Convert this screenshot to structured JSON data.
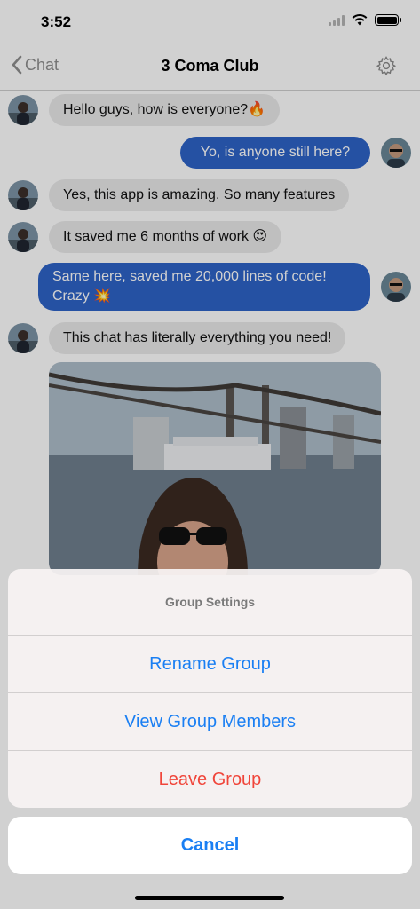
{
  "status_bar": {
    "time": "3:52"
  },
  "nav": {
    "back_label": "Chat",
    "title": "3 Coma Club"
  },
  "messages": [
    {
      "text": "Hello guys, how is everyone?🔥",
      "direction": "incoming"
    },
    {
      "text": "Yo, is anyone still here?",
      "direction": "outgoing"
    },
    {
      "text": "Yes, this app is amazing. So many features",
      "direction": "incoming"
    },
    {
      "text": "It saved me 6 months of work 😍",
      "direction": "incoming"
    },
    {
      "text": "Same here, saved me 20,000 lines of code! Crazy 💥",
      "direction": "outgoing"
    },
    {
      "text": "This chat has literally everything you need!",
      "direction": "incoming"
    }
  ],
  "action_sheet": {
    "title": "Group Settings",
    "options": [
      "Rename Group",
      "View Group Members",
      "Leave Group"
    ],
    "cancel_label": "Cancel"
  },
  "colors": {
    "outgoing_bubble": "#2e63c7",
    "incoming_bubble": "#e9e9ea",
    "action_blue": "#1a7ff3",
    "destructive_red": "#f0453a"
  },
  "icons": [
    "chevron-left-icon",
    "gear-icon",
    "wifi-icon",
    "signal-icon",
    "battery-icon"
  ]
}
